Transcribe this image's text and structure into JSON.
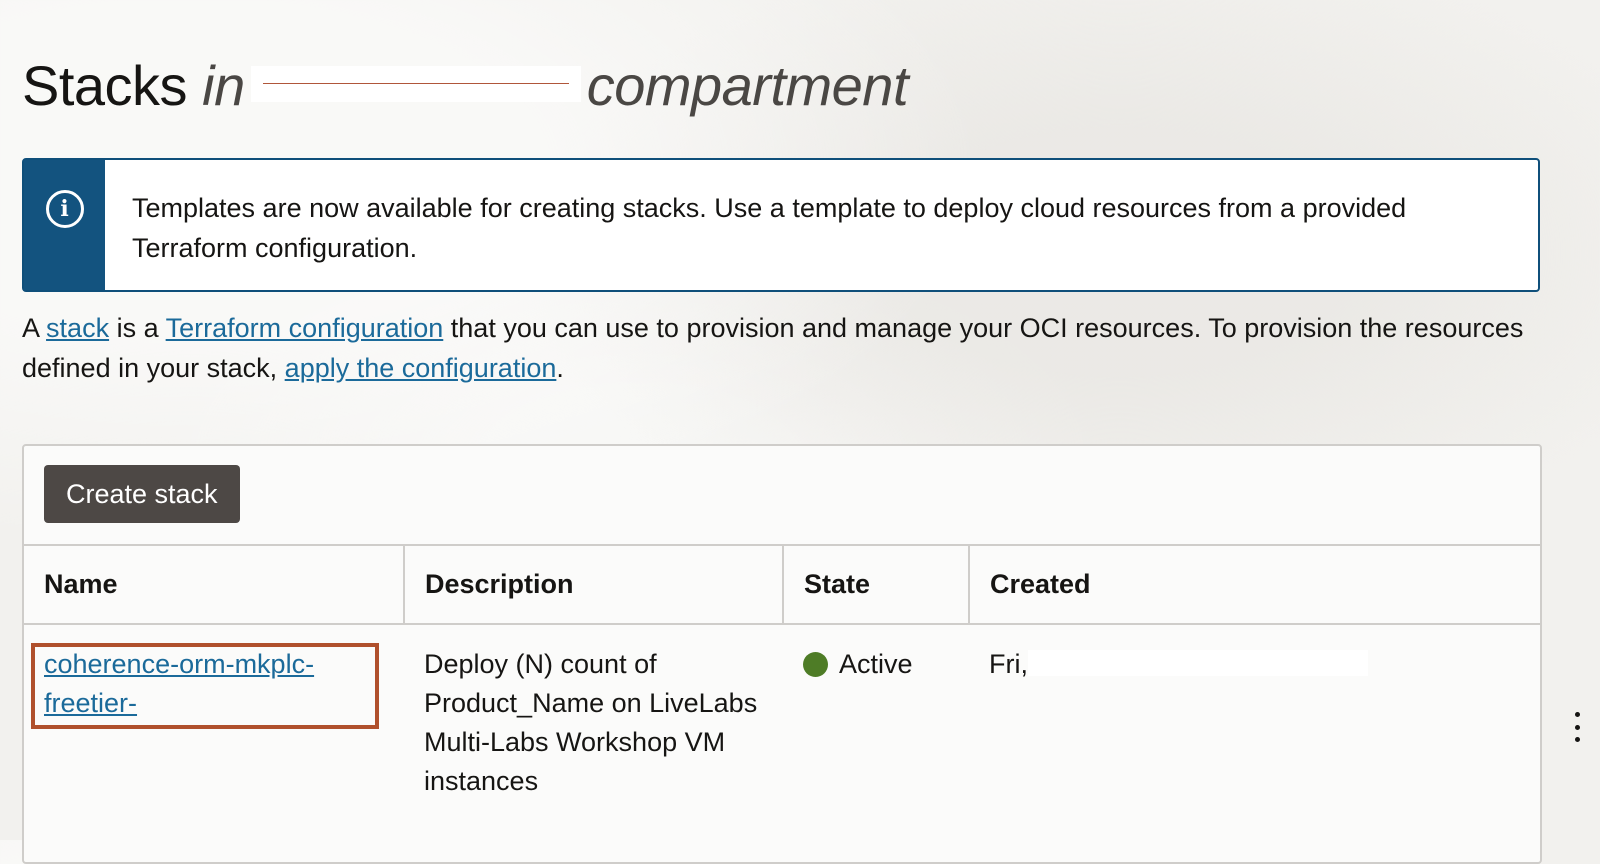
{
  "header": {
    "title_prefix": "Stacks",
    "title_in": "in",
    "title_suffix": "compartment"
  },
  "banner": {
    "icon": "info-icon",
    "text": "Templates are now available for creating stacks. Use a template to deploy cloud resources from a provided Terraform configuration."
  },
  "intro": {
    "a": "A",
    "stack_link": "stack",
    "is_a": "is a",
    "terraform_link": "Terraform configuration",
    "middle": "that you can use to provision and manage your OCI resources. To provision the resources defined in your stack,",
    "apply_link": "apply the configuration",
    "end": "."
  },
  "toolbar": {
    "create_label": "Create stack"
  },
  "table": {
    "columns": [
      "Name",
      "Description",
      "State",
      "Created"
    ],
    "rows": [
      {
        "name": "coherence-orm-mkplc-freetier-",
        "description": "Deploy (N) count of Product_Name on LiveLabs Multi-Labs Workshop VM instances",
        "state": "Active",
        "state_color": "#4e7c26",
        "created": "Fri,"
      }
    ]
  },
  "colors": {
    "banner_accent": "#13537f",
    "link": "#1b6a9a",
    "highlight_box": "#b0502c",
    "button_bg": "#4d4845"
  }
}
